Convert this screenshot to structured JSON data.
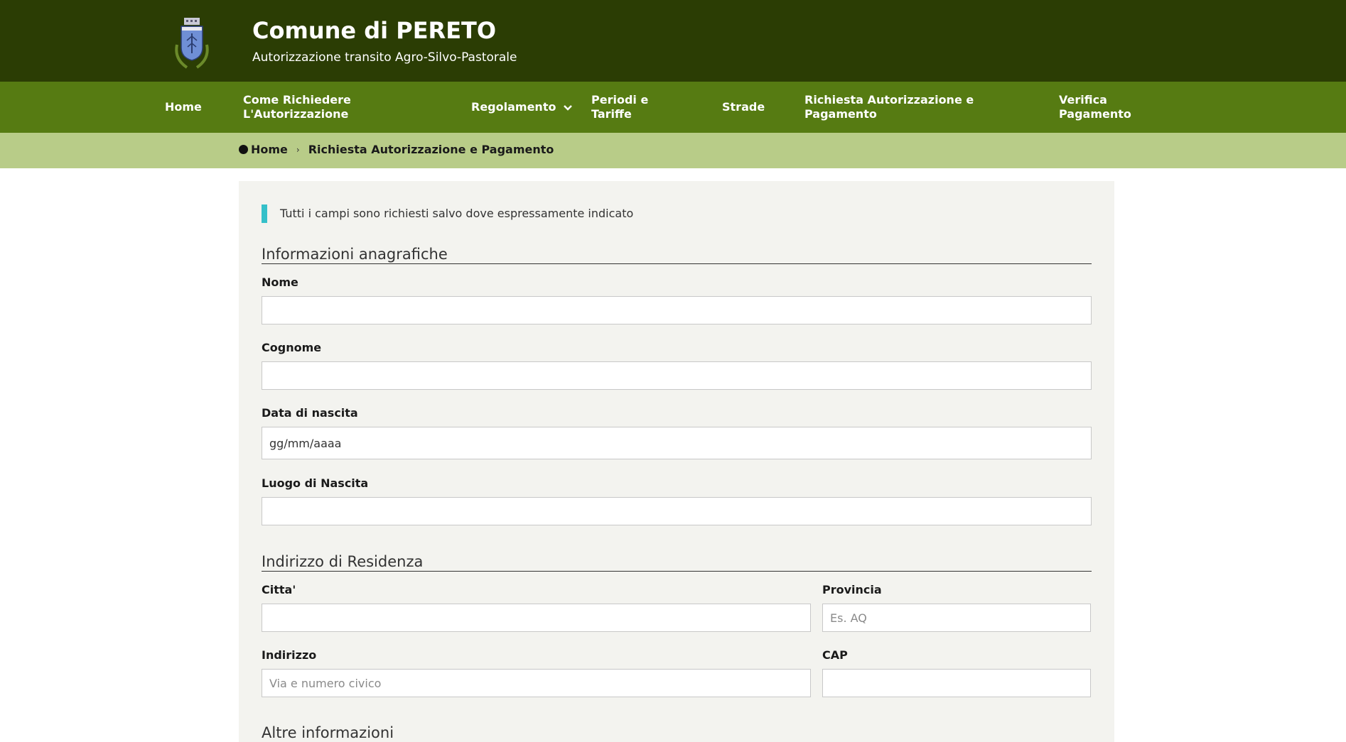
{
  "header": {
    "title": "Comune di PERETO",
    "subtitle": "Autorizzazione transito Agro-Silvo-Pastorale",
    "logo_icon": "coat-of-arms-icon"
  },
  "nav": {
    "items": [
      {
        "label1": "Home",
        "label2": ""
      },
      {
        "label1": "Come Richiedere",
        "label2": "L'Autorizzazione"
      },
      {
        "label1": "Regolamento",
        "label2": ""
      },
      {
        "label1": "Periodi e",
        "label2": "Tariffe"
      },
      {
        "label1": "Strade",
        "label2": ""
      },
      {
        "label1": "Richiesta Autorizzazione e",
        "label2": "Pagamento"
      },
      {
        "label1": "Verifica",
        "label2": "Pagamento"
      }
    ]
  },
  "breadcrumb": {
    "home": "Home",
    "separator": "›",
    "current": "Richiesta Autorizzazione e Pagamento"
  },
  "form": {
    "notice": "Tutti i campi sono richiesti salvo dove espressamente indicato",
    "section_personal": "Informazioni anagrafiche",
    "nome_label": "Nome",
    "cognome_label": "Cognome",
    "data_label": "Data di nascita",
    "data_placeholder": "gg/mm/aaaa",
    "luogo_label": "Luogo di Nascita",
    "section_address": "Indirizzo di Residenza",
    "citta_label": "Citta'",
    "provincia_label": "Provincia",
    "provincia_placeholder": "Es. AQ",
    "indirizzo_label": "Indirizzo",
    "indirizzo_placeholder": "Via e numero civico",
    "cap_label": "CAP",
    "section_other": "Altre informazioni"
  },
  "colors": {
    "header_bg": "#2b3d04",
    "nav_bg": "#567b12",
    "breadcrumb_bg": "#b8cc88",
    "notice_accent": "#35c0c9",
    "panel_bg": "#f3f3ef"
  }
}
